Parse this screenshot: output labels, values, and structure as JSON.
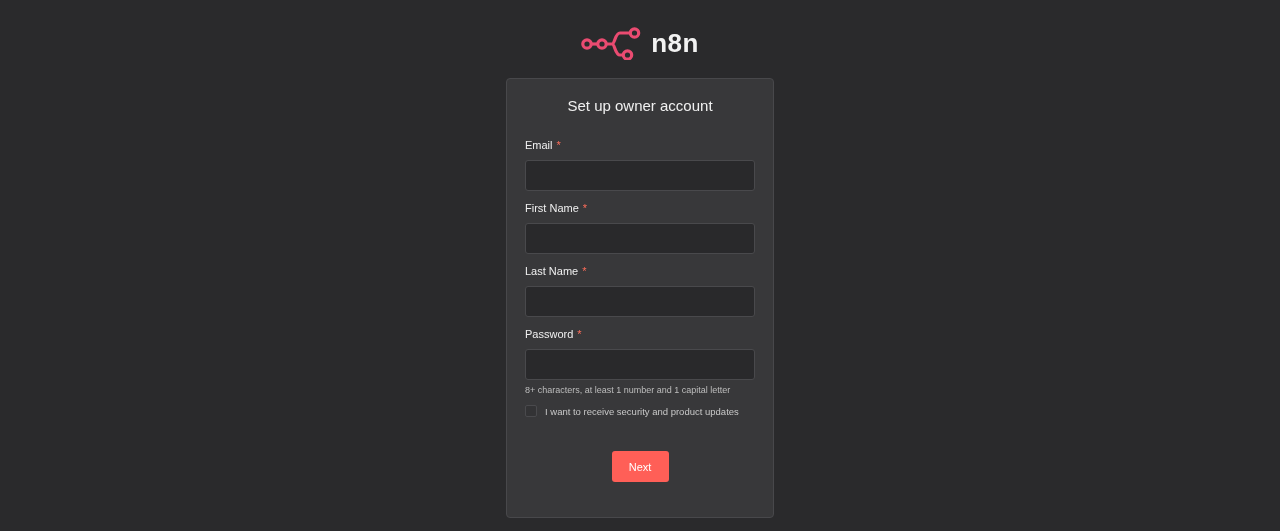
{
  "logo": {
    "text": "n8n"
  },
  "card": {
    "title": "Set up owner account",
    "fields": [
      {
        "label": "Email",
        "required_mark": "*"
      },
      {
        "label": "First Name",
        "required_mark": "*"
      },
      {
        "label": "Last Name",
        "required_mark": "*"
      },
      {
        "label": "Password",
        "required_mark": "*",
        "hint": "8+ characters, at least 1 number and 1 capital letter"
      }
    ],
    "checkbox": {
      "label": "I want to receive security and product updates",
      "checked": false
    },
    "button": "Next"
  }
}
